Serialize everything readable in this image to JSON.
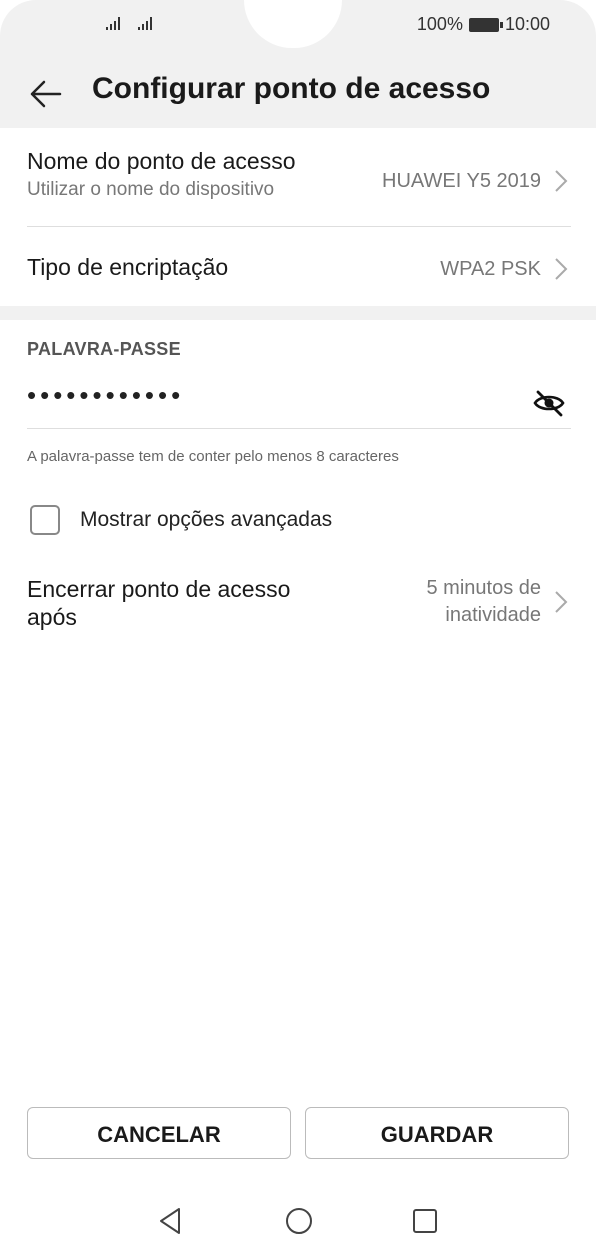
{
  "status_bar": {
    "battery": "100%",
    "time": "10:00"
  },
  "header": {
    "title": "Configurar ponto de acesso",
    "back_icon": "arrow-left-icon"
  },
  "settings": {
    "ap_name": {
      "label": "Nome do ponto de acesso",
      "sub": "Utilizar o nome do dispositivo",
      "value": "HUAWEI Y5 2019"
    },
    "encryption": {
      "label": "Tipo de encriptação",
      "value": "WPA2 PSK"
    }
  },
  "password": {
    "section_title": "PALAVRA-PASSE",
    "value": "••••••••••••",
    "hint": "A palavra-passe tem de conter pelo menos 8 caracteres",
    "visibility_icon": "eye-off-icon"
  },
  "advanced": {
    "label": "Mostrar opções avançadas",
    "checked": false
  },
  "auto_off": {
    "label_line1": "Encerrar ponto de acesso",
    "label_line2": "após",
    "value_line1": "5 minutos de",
    "value_line2": "inatividade"
  },
  "buttons": {
    "cancel": "CANCELAR",
    "save": "GUARDAR"
  },
  "nav": {
    "back": "triangle-back-icon",
    "home": "circle-home-icon",
    "recent": "square-recent-icon"
  }
}
